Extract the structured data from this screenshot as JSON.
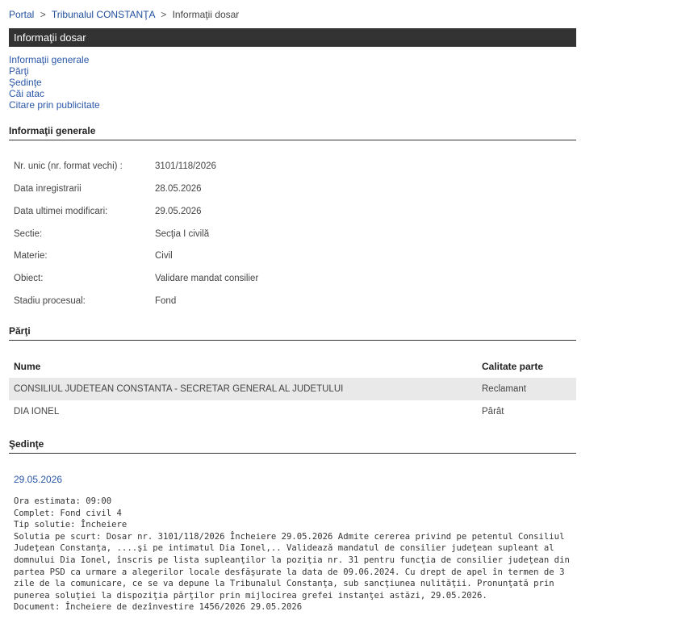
{
  "breadcrumb": {
    "portal": "Portal",
    "sep": ">",
    "court": "Tribunalul CONSTANŢA",
    "current": "Informaţii dosar"
  },
  "title_bar": "Informaţii dosar",
  "quick_links": [
    "Informaţii generale",
    "Părţi",
    "Şedinţe",
    "Căi atac",
    "Citare prin publicitate"
  ],
  "sections": {
    "general": "Informaţii generale",
    "parti": "Părţi",
    "sedinte": "Şedinţe"
  },
  "general_info": [
    {
      "label": "Nr. unic (nr. format vechi) :",
      "value": "3101/118/2026"
    },
    {
      "label": "Data inregistrarii",
      "value": "28.05.2026"
    },
    {
      "label": "Data ultimei modificari:",
      "value": "29.05.2026"
    },
    {
      "label": "Sectie:",
      "value": "Secţia I civilă"
    },
    {
      "label": "Materie:",
      "value": "Civil"
    },
    {
      "label": "Obiect:",
      "value": "Validare mandat consilier"
    },
    {
      "label": "Stadiu procesual:",
      "value": "Fond"
    }
  ],
  "parti_table": {
    "headers": {
      "name": "Nume",
      "role": "Calitate parte"
    },
    "rows": [
      {
        "name": "CONSILIUL JUDETEAN CONSTANTA - SECRETAR GENERAL AL JUDETULUI",
        "role": "Reclamant"
      },
      {
        "name": "DIA IONEL",
        "role": "Pârât"
      }
    ]
  },
  "sedinta": {
    "date": "29.05.2026",
    "ora": "Ora estimata: 09:00",
    "complet": "Complet: Fond civil 4",
    "tip": "Tip solutie: Încheiere",
    "solutie": "Solutia pe scurt: Dosar nr. 3101/118/2026 Încheiere 29.05.2026 Admite cererea privind pe petentul Consiliul Judeţean Constanţa, ....şi pe intimatul Dia Ionel,.. Validează mandatul de consilier judeţean supleant al domnului Dia Ionel, înscris pe lista supleanţilor la poziţia nr. 31 pentru funcţia de consilier judeţean din partea PSD ca urmare a alegerilor locale desfăşurate la data de 09.06.2024. Cu drept de apel în termen de 3 zile de la comunicare, ce se va depune la Tribunalul Constanţa, sub sancţiunea nulităţii. Pronunţată prin punerea soluţiei la dispoziţia părţilor prin mijlocirea grefei instanţei astăzi, 29.05.2026.",
    "document": "Document: Încheiere de dezînvestire  1456/2026  29.05.2026"
  }
}
